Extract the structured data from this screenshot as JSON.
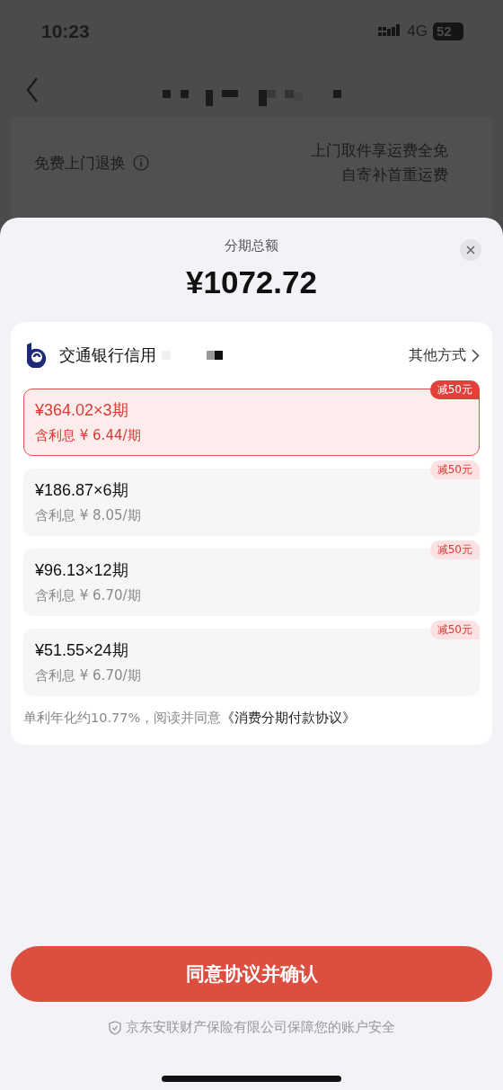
{
  "status_bar": {
    "time": "10:23",
    "network": "4G",
    "battery": "52"
  },
  "background_page": {
    "rows": [
      {
        "label": "免费上门退换",
        "values": [
          "上门取件享运费全免",
          "自寄补首重运费"
        ]
      }
    ]
  },
  "sheet": {
    "title": "分期总额",
    "amount": "¥1072.72",
    "card": {
      "bank_name": "交通银行信用",
      "other_methods": "其他方式"
    },
    "plans": [
      {
        "amount": "¥364.02×3期",
        "interest": "含利息 ¥ 6.44/期",
        "badge": "减50元",
        "selected": true
      },
      {
        "amount": "¥186.87×6期",
        "interest": "含利息 ¥ 8.05/期",
        "badge": "减50元",
        "selected": false
      },
      {
        "amount": "¥96.13×12期",
        "interest": "含利息 ¥ 6.70/期",
        "badge": "减50元",
        "selected": false
      },
      {
        "amount": "¥51.55×24期",
        "interest": "含利息 ¥ 6.70/期",
        "badge": "减50元",
        "selected": false
      }
    ],
    "note": "单利年化约10.77%，阅读并同意",
    "agreement_link": "《消费分期付款协议》",
    "confirm_button": "同意协议并确认",
    "security_note": "京东安联财产保险有限公司保障您的账户安全"
  }
}
